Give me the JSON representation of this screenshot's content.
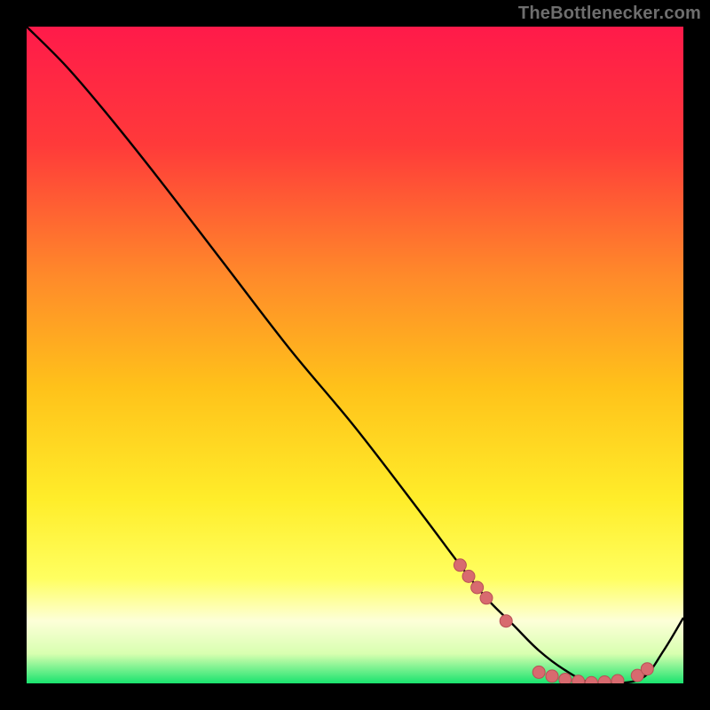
{
  "attribution": {
    "text": "TheBottlenecker.com"
  },
  "colors": {
    "background": "#000000",
    "gradient_top": "#ff1a4a",
    "gradient_mid1": "#ff6a2a",
    "gradient_mid2": "#ffd21a",
    "gradient_mid3": "#ffff40",
    "gradient_band_light": "#fdffd0",
    "gradient_bottom": "#19e36e",
    "curve": "#000000",
    "marker_fill": "#d86a6f",
    "marker_stroke": "#b85055"
  },
  "chart_data": {
    "type": "line",
    "title": "",
    "xlabel": "",
    "ylabel": "",
    "xlim": [
      0,
      100
    ],
    "ylim": [
      0,
      100
    ],
    "series": [
      {
        "name": "bottleneck-curve",
        "x": [
          0,
          6,
          12,
          20,
          30,
          40,
          50,
          60,
          66,
          70,
          74,
          78,
          82,
          86,
          90,
          94,
          97,
          100
        ],
        "y": [
          100,
          94,
          87,
          77,
          64,
          51,
          39,
          26,
          18,
          13,
          9,
          5,
          2,
          0,
          0,
          1,
          5,
          10
        ]
      }
    ],
    "markers": [
      {
        "name": "marker-segment-a",
        "x": [
          66,
          67.3,
          68.6,
          70
        ],
        "y": [
          18,
          16.3,
          14.6,
          13
        ]
      },
      {
        "name": "marker-single-b",
        "x": [
          73
        ],
        "y": [
          9.5
        ]
      },
      {
        "name": "marker-flat-c",
        "x": [
          78,
          80,
          82,
          84,
          86,
          88,
          90
        ],
        "y": [
          1.7,
          1.1,
          0.6,
          0.3,
          0.1,
          0.2,
          0.4
        ]
      },
      {
        "name": "marker-segment-d",
        "x": [
          93,
          94.5
        ],
        "y": [
          1.2,
          2.2
        ]
      }
    ],
    "gradient_stops": [
      {
        "offset": 0.0,
        "color": "#ff1a4a"
      },
      {
        "offset": 0.18,
        "color": "#ff3a3a"
      },
      {
        "offset": 0.38,
        "color": "#ff8a2a"
      },
      {
        "offset": 0.55,
        "color": "#ffc21a"
      },
      {
        "offset": 0.72,
        "color": "#ffed2a"
      },
      {
        "offset": 0.84,
        "color": "#ffff60"
      },
      {
        "offset": 0.905,
        "color": "#fdffd8"
      },
      {
        "offset": 0.955,
        "color": "#d8ffb0"
      },
      {
        "offset": 1.0,
        "color": "#19e36e"
      }
    ]
  }
}
